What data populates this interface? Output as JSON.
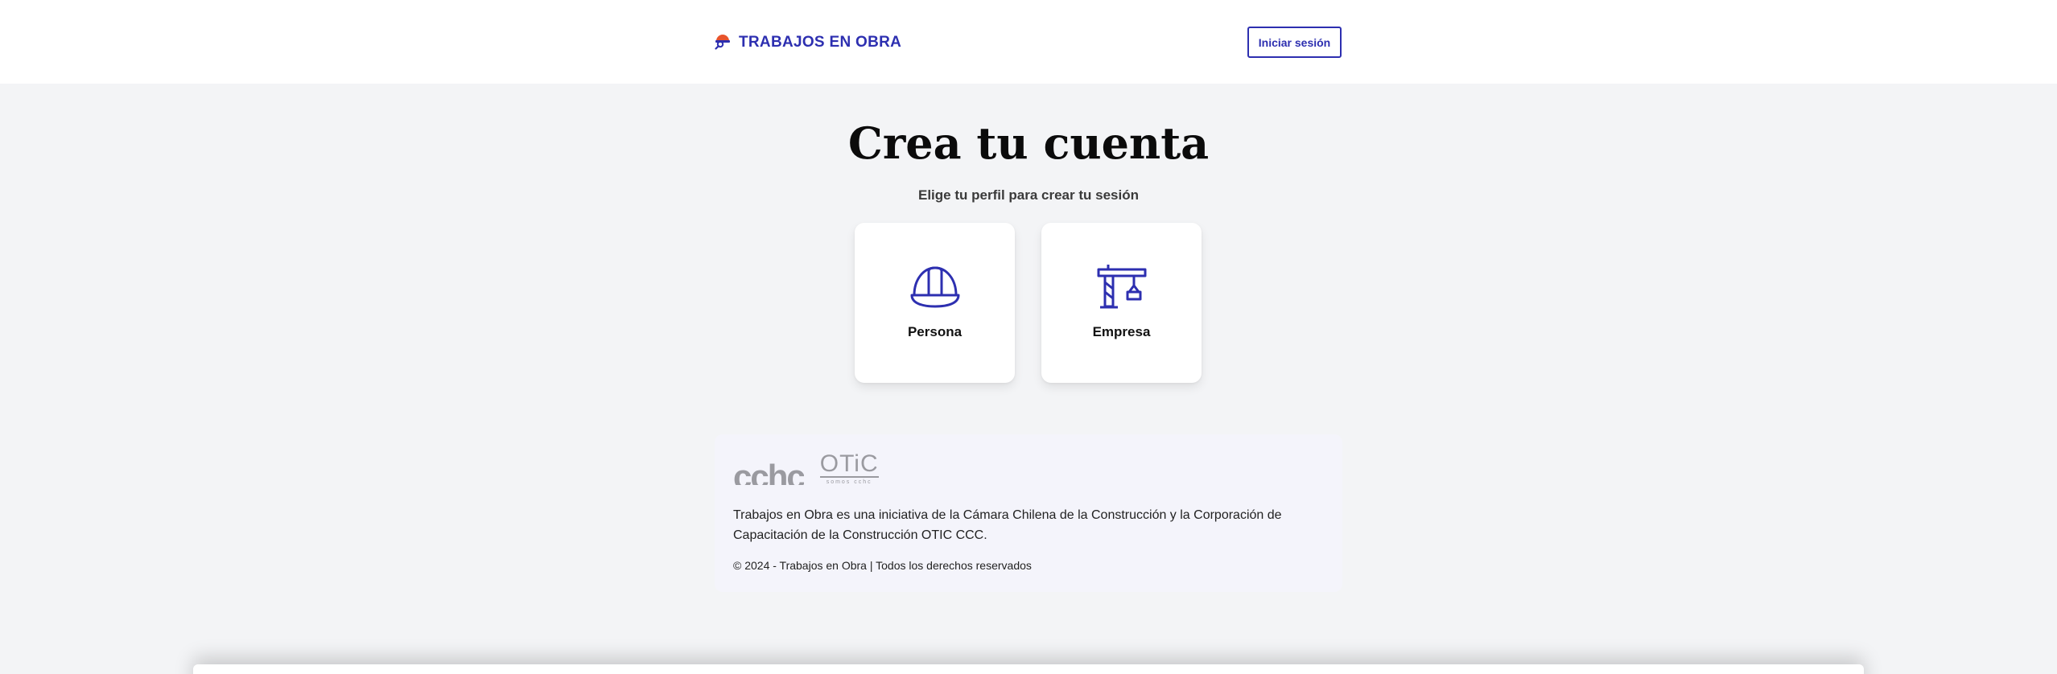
{
  "header": {
    "brand_icon": "helmet-magnifier-icon",
    "brand_text": "TRABAJOS EN OBRA",
    "login_label": "Iniciar sesión"
  },
  "main": {
    "title": "Crea tu cuenta",
    "subtitle": "Elige tu perfil para crear tu sesión",
    "options": [
      {
        "label": "Persona",
        "icon": "hard-hat-icon"
      },
      {
        "label": "Empresa",
        "icon": "crane-icon"
      }
    ]
  },
  "footer_info": {
    "logo_cchc": "cchc",
    "logo_otic_main": "OTiC",
    "logo_otic_sub": "somos cchc",
    "description": "Trabajos en Obra es una iniciativa de la Cámara Chilena de la Construcción y la Corporación de Capacitación de la Construcción OTIC CCC.",
    "copyright": "© 2024 - Trabajos en Obra | Todos los derechos reservados"
  },
  "colors": {
    "brand": "#2d2fb0",
    "background": "#f3f4f6",
    "card": "#ffffff",
    "accent_helmet": "#e8542c"
  }
}
